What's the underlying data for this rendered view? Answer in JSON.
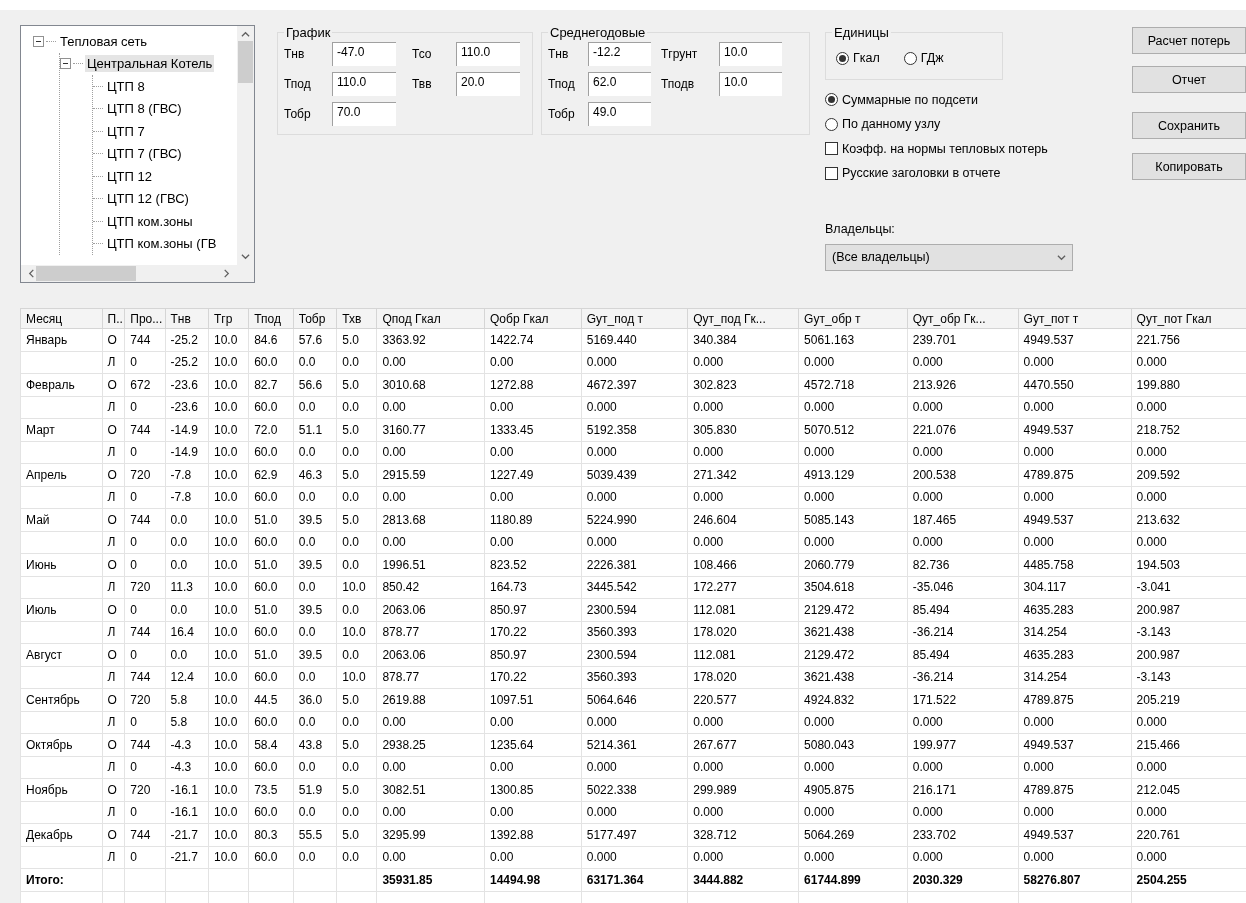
{
  "tree": {
    "items": [
      {
        "label": "Тепловая сеть",
        "expanded": true,
        "selected": false,
        "children": [
          {
            "label": "Центральная Котель",
            "expanded": true,
            "selected": true,
            "children": [
              {
                "label": "ЦТП 8",
                "selected": false
              },
              {
                "label": "ЦТП 8 (ГВС)",
                "selected": false
              },
              {
                "label": "ЦТП 7",
                "selected": false
              },
              {
                "label": "ЦТП 7 (ГВС)",
                "selected": false
              },
              {
                "label": "ЦТП 12",
                "selected": false
              },
              {
                "label": "ЦТП 12 (ГВС)",
                "selected": false
              },
              {
                "label": "ЦТП ком.зоны",
                "selected": false
              },
              {
                "label": "ЦТП ком.зоны (ГВ",
                "selected": false
              }
            ]
          }
        ]
      }
    ]
  },
  "groups": [
    {
      "title": "График",
      "fields": [
        {
          "label": "Тнв",
          "value": "-47.0"
        },
        {
          "label": "Тсо",
          "value": "110.0"
        },
        {
          "label": "Тпод",
          "value": "110.0"
        },
        {
          "label": "Твв",
          "value": "20.0"
        },
        {
          "label": "Тобр",
          "value": "70.0"
        }
      ]
    },
    {
      "title": "Среднегодовые",
      "fields": [
        {
          "label": "Тнв",
          "value": "-12.2"
        },
        {
          "label": "Тгрунт",
          "value": "10.0"
        },
        {
          "label": "Тпод",
          "value": "62.0"
        },
        {
          "label": "Тподв",
          "value": "10.0"
        },
        {
          "label": "Тобр",
          "value": "49.0"
        }
      ]
    }
  ],
  "units": {
    "title": "Единицы",
    "options": [
      {
        "label": "Гкал",
        "selected": true
      },
      {
        "label": "ГДж",
        "selected": false
      }
    ]
  },
  "scope": [
    {
      "label": "Суммарные по подсети",
      "selected": true
    },
    {
      "label": "По данному узлу",
      "selected": false
    }
  ],
  "checkboxes": [
    {
      "label": "Коэфф. на нормы тепловых потерь",
      "checked": false
    },
    {
      "label": "Русские заголовки в отчете",
      "checked": false
    }
  ],
  "owners": {
    "label": "Владельцы:",
    "value": "(Все владельцы)"
  },
  "buttons": [
    "Расчет потерь",
    "Отчет",
    "Сохранить",
    "Копировать"
  ],
  "table": {
    "columns": [
      "Месяц",
      "П..",
      "Про...",
      "Тнв",
      "Тгр",
      "Тпод",
      "Тобр",
      "Тхв",
      "Qпод Гкал",
      "Qобр Гкал",
      "Gyт_под т",
      "Qyт_под Гк...",
      "Gyт_обр т",
      "Qyт_обр Гк...",
      "Gyт_пот т",
      "Qyт_пот Гкал"
    ],
    "rows": [
      {
        "cells": [
          "Январь",
          "О",
          "744",
          "-25.2",
          "10.0",
          "84.6",
          "57.6",
          "5.0",
          "3363.92",
          "1422.74",
          "5169.440",
          "340.384",
          "5061.163",
          "239.701",
          "4949.537",
          "221.756"
        ]
      },
      {
        "cells": [
          "",
          "Л",
          "0",
          "-25.2",
          "10.0",
          "60.0",
          "0.0",
          "0.0",
          "0.00",
          "0.00",
          "0.000",
          "0.000",
          "0.000",
          "0.000",
          "0.000",
          "0.000"
        ]
      },
      {
        "cells": [
          "Февраль",
          "О",
          "672",
          "-23.6",
          "10.0",
          "82.7",
          "56.6",
          "5.0",
          "3010.68",
          "1272.88",
          "4672.397",
          "302.823",
          "4572.718",
          "213.926",
          "4470.550",
          "199.880"
        ]
      },
      {
        "cells": [
          "",
          "Л",
          "0",
          "-23.6",
          "10.0",
          "60.0",
          "0.0",
          "0.0",
          "0.00",
          "0.00",
          "0.000",
          "0.000",
          "0.000",
          "0.000",
          "0.000",
          "0.000"
        ]
      },
      {
        "cells": [
          "Март",
          "О",
          "744",
          "-14.9",
          "10.0",
          "72.0",
          "51.1",
          "5.0",
          "3160.77",
          "1333.45",
          "5192.358",
          "305.830",
          "5070.512",
          "221.076",
          "4949.537",
          "218.752"
        ]
      },
      {
        "cells": [
          "",
          "Л",
          "0",
          "-14.9",
          "10.0",
          "60.0",
          "0.0",
          "0.0",
          "0.00",
          "0.00",
          "0.000",
          "0.000",
          "0.000",
          "0.000",
          "0.000",
          "0.000"
        ]
      },
      {
        "cells": [
          "Апрель",
          "О",
          "720",
          "-7.8",
          "10.0",
          "62.9",
          "46.3",
          "5.0",
          "2915.59",
          "1227.49",
          "5039.439",
          "271.342",
          "4913.129",
          "200.538",
          "4789.875",
          "209.592"
        ]
      },
      {
        "cells": [
          "",
          "Л",
          "0",
          "-7.8",
          "10.0",
          "60.0",
          "0.0",
          "0.0",
          "0.00",
          "0.00",
          "0.000",
          "0.000",
          "0.000",
          "0.000",
          "0.000",
          "0.000"
        ]
      },
      {
        "cells": [
          "Май",
          "О",
          "744",
          "0.0",
          "10.0",
          "51.0",
          "39.5",
          "5.0",
          "2813.68",
          "1180.89",
          "5224.990",
          "246.604",
          "5085.143",
          "187.465",
          "4949.537",
          "213.632"
        ]
      },
      {
        "cells": [
          "",
          "Л",
          "0",
          "0.0",
          "10.0",
          "60.0",
          "0.0",
          "0.0",
          "0.00",
          "0.00",
          "0.000",
          "0.000",
          "0.000",
          "0.000",
          "0.000",
          "0.000"
        ]
      },
      {
        "cells": [
          "Июнь",
          "О",
          "0",
          "0.0",
          "10.0",
          "51.0",
          "39.5",
          "0.0",
          "1996.51",
          "823.52",
          "2226.381",
          "108.466",
          "2060.779",
          "82.736",
          "4485.758",
          "194.503"
        ]
      },
      {
        "cells": [
          "",
          "Л",
          "720",
          "11.3",
          "10.0",
          "60.0",
          "0.0",
          "10.0",
          "850.42",
          "164.73",
          "3445.542",
          "172.277",
          "3504.618",
          "-35.046",
          "304.117",
          "-3.041"
        ]
      },
      {
        "cells": [
          "Июль",
          "О",
          "0",
          "0.0",
          "10.0",
          "51.0",
          "39.5",
          "0.0",
          "2063.06",
          "850.97",
          "2300.594",
          "112.081",
          "2129.472",
          "85.494",
          "4635.283",
          "200.987"
        ]
      },
      {
        "cells": [
          "",
          "Л",
          "744",
          "16.4",
          "10.0",
          "60.0",
          "0.0",
          "10.0",
          "878.77",
          "170.22",
          "3560.393",
          "178.020",
          "3621.438",
          "-36.214",
          "314.254",
          "-3.143"
        ]
      },
      {
        "cells": [
          "Август",
          "О",
          "0",
          "0.0",
          "10.0",
          "51.0",
          "39.5",
          "0.0",
          "2063.06",
          "850.97",
          "2300.594",
          "112.081",
          "2129.472",
          "85.494",
          "4635.283",
          "200.987"
        ]
      },
      {
        "cells": [
          "",
          "Л",
          "744",
          "12.4",
          "10.0",
          "60.0",
          "0.0",
          "10.0",
          "878.77",
          "170.22",
          "3560.393",
          "178.020",
          "3621.438",
          "-36.214",
          "314.254",
          "-3.143"
        ]
      },
      {
        "cells": [
          "Сентябрь",
          "О",
          "720",
          "5.8",
          "10.0",
          "44.5",
          "36.0",
          "5.0",
          "2619.88",
          "1097.51",
          "5064.646",
          "220.577",
          "4924.832",
          "171.522",
          "4789.875",
          "205.219"
        ]
      },
      {
        "cells": [
          "",
          "Л",
          "0",
          "5.8",
          "10.0",
          "60.0",
          "0.0",
          "0.0",
          "0.00",
          "0.00",
          "0.000",
          "0.000",
          "0.000",
          "0.000",
          "0.000",
          "0.000"
        ]
      },
      {
        "cells": [
          "Октябрь",
          "О",
          "744",
          "-4.3",
          "10.0",
          "58.4",
          "43.8",
          "5.0",
          "2938.25",
          "1235.64",
          "5214.361",
          "267.677",
          "5080.043",
          "199.977",
          "4949.537",
          "215.466"
        ]
      },
      {
        "cells": [
          "",
          "Л",
          "0",
          "-4.3",
          "10.0",
          "60.0",
          "0.0",
          "0.0",
          "0.00",
          "0.00",
          "0.000",
          "0.000",
          "0.000",
          "0.000",
          "0.000",
          "0.000"
        ]
      },
      {
        "cells": [
          "Ноябрь",
          "О",
          "720",
          "-16.1",
          "10.0",
          "73.5",
          "51.9",
          "5.0",
          "3082.51",
          "1300.85",
          "5022.338",
          "299.989",
          "4905.875",
          "216.171",
          "4789.875",
          "212.045"
        ]
      },
      {
        "cells": [
          "",
          "Л",
          "0",
          "-16.1",
          "10.0",
          "60.0",
          "0.0",
          "0.0",
          "0.00",
          "0.00",
          "0.000",
          "0.000",
          "0.000",
          "0.000",
          "0.000",
          "0.000"
        ]
      },
      {
        "cells": [
          "Декабрь",
          "О",
          "744",
          "-21.7",
          "10.0",
          "80.3",
          "55.5",
          "5.0",
          "3295.99",
          "1392.88",
          "5177.497",
          "328.712",
          "5064.269",
          "233.702",
          "4949.537",
          "220.761"
        ]
      },
      {
        "cells": [
          "",
          "Л",
          "0",
          "-21.7",
          "10.0",
          "60.0",
          "0.0",
          "0.0",
          "0.00",
          "0.00",
          "0.000",
          "0.000",
          "0.000",
          "0.000",
          "0.000",
          "0.000"
        ]
      }
    ],
    "totals": {
      "label": "Итого:",
      "values": [
        "35931.85",
        "14494.98",
        "63171.364",
        "3444.882",
        "61744.899",
        "2030.329",
        "58276.807",
        "2504.255"
      ]
    }
  }
}
